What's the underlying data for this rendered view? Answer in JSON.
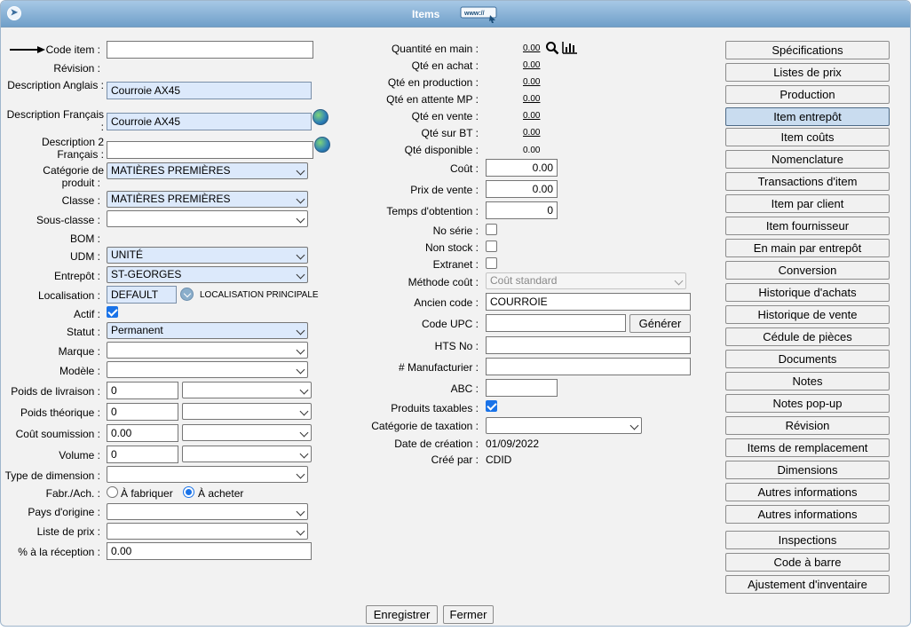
{
  "window": {
    "title": "Items"
  },
  "left": {
    "code_item_label": "Code item :",
    "code_item_value": "",
    "revision_label": "Révision :",
    "desc_en_label": "Description Anglais :",
    "desc_en_value": "Courroie AX45",
    "desc_fr_label1": "Description Français",
    "desc_fr_label2": ":",
    "desc_fr_value": "Courroie AX45",
    "desc2_label1": "Description 2",
    "desc2_label2": "Français :",
    "desc2_value": "",
    "categorie_label1": "Catégorie de",
    "categorie_label2": "produit :",
    "categorie_value": "MATIÈRES PREMIÈRES",
    "classe_label": "Classe :",
    "classe_value": "MATIÈRES PREMIÈRES",
    "sousclasse_label": "Sous-classe :",
    "sousclasse_value": "",
    "bom_label": "BOM :",
    "udm_label": "UDM :",
    "udm_value": "UNITÉ",
    "entrepot_label": "Entrepôt :",
    "entrepot_value": "ST-GEORGES",
    "localisation_label": "Localisation :",
    "localisation_value": "DEFAULT",
    "localisation_principale": "LOCALISATION PRINCIPALE",
    "actif_label": "Actif :",
    "statut_label": "Statut :",
    "statut_value": "Permanent",
    "marque_label": "Marque :",
    "modele_label": "Modèle :",
    "poids_livraison_label": "Poids de livraison :",
    "poids_livraison_value": "0",
    "poids_theorique_label": "Poids théorique :",
    "poids_theorique_value": "0",
    "cout_soumission_label": "Coût soumission :",
    "cout_soumission_value": "0.00",
    "volume_label": "Volume :",
    "volume_value": "0",
    "type_dimension_label": "Type de dimension :",
    "fabr_label": "Fabr./Ach. :",
    "a_fabriquer": "À fabriquer",
    "a_acheter": "À acheter",
    "pays_label": "Pays d'origine :",
    "liste_prix_label": "Liste de prix :",
    "pct_reception_label": "% à la réception :",
    "pct_reception_value": "0.00"
  },
  "middle": {
    "qte_main_label": "Quantité en main :",
    "qte_main_value": "0.00",
    "qte_achat_label": "Qté en achat :",
    "qte_achat_value": "0.00",
    "qte_production_label": "Qté en production :",
    "qte_production_value": "0.00",
    "qte_attente_label": "Qté en attente MP :",
    "qte_attente_value": "0.00",
    "qte_vente_label": "Qté en vente :",
    "qte_vente_value": "0.00",
    "qte_bt_label": "Qté sur BT :",
    "qte_bt_value": "0.00",
    "qte_dispo_label": "Qté disponible :",
    "qte_dispo_value": "0.00",
    "cout_label": "Coût :",
    "cout_value": "0.00",
    "prix_vente_label": "Prix de vente :",
    "prix_vente_value": "0.00",
    "temps_label": "Temps d'obtention :",
    "temps_value": "0",
    "no_serie_label": "No série :",
    "non_stock_label": "Non stock :",
    "extranet_label": "Extranet :",
    "methode_cout_label": "Méthode coût :",
    "methode_cout_value": "Coût standard",
    "ancien_code_label": "Ancien code :",
    "ancien_code_value": "COURROIE",
    "code_upc_label": "Code UPC :",
    "generer_label": "Générer",
    "hts_label": "HTS No :",
    "manufacturier_label": "# Manufacturier :",
    "abc_label": "ABC :",
    "produits_taxables_label": "Produits taxables :",
    "cat_taxation_label": "Catégorie de taxation :",
    "date_creation_label": "Date de création :",
    "date_creation_value": "01/09/2022",
    "cree_par_label": "Créé par :",
    "cree_par_value": "CDID"
  },
  "right_buttons": [
    "Spécifications",
    "Listes de prix",
    "Production",
    "Item entrepôt",
    "Item coûts",
    "Nomenclature",
    "Transactions d'item",
    "Item par client",
    "Item fournisseur",
    "En main par entrepôt",
    "Conversion",
    "Historique d'achats",
    "Historique de vente",
    "Cédule de pièces",
    "Documents",
    "Notes",
    "Notes pop-up",
    "Révision",
    "Items de remplacement",
    "Dimensions",
    "Autres informations",
    "Autres informations",
    "Inspections",
    "Code à barre",
    "Ajustement d'inventaire"
  ],
  "footer": {
    "save": "Enregistrer",
    "close": "Fermer"
  }
}
